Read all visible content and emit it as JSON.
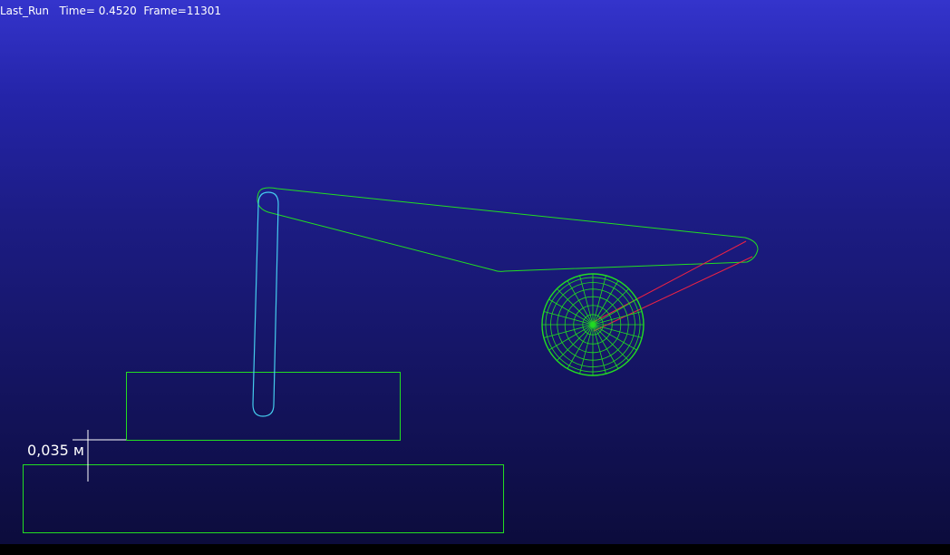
{
  "hud": {
    "run_name": "Last_Run",
    "time_label": "Time=",
    "time_value": "0.4520",
    "frame_label": "Frame=",
    "frame_value": "11301"
  },
  "dimension": {
    "label": "0,035 м"
  },
  "colors": {
    "background_top": "#3434cc",
    "background_bottom": "#0c0c3c",
    "green_part": "#22dd22",
    "cyan_link": "#44ccee",
    "red_link": "#ee2244",
    "hud_text": "#ffffff"
  },
  "objects": [
    "link-body",
    "crank-link",
    "rod-link",
    "wheel",
    "upper-block",
    "lower-block",
    "dimension-marker"
  ]
}
